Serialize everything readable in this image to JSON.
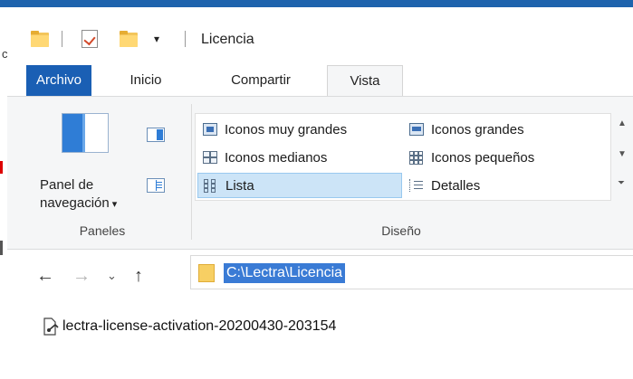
{
  "window": {
    "title": "Licencia"
  },
  "quick_access": {
    "icons": [
      "folder-icon",
      "properties-icon",
      "new-folder-icon",
      "customize-toolbar-icon"
    ]
  },
  "tabs": [
    {
      "label": "Archivo"
    },
    {
      "label": "Inicio"
    },
    {
      "label": "Compartir"
    },
    {
      "label": "Vista"
    }
  ],
  "ribbon": {
    "panes_group": {
      "nav_pane_label_line1": "Panel de",
      "nav_pane_label_line2": "navegación",
      "group_label": "Paneles"
    },
    "layout_group": {
      "items": [
        {
          "label": "Iconos muy grandes"
        },
        {
          "label": "Iconos grandes"
        },
        {
          "label": "Iconos medianos"
        },
        {
          "label": "Iconos pequeños"
        },
        {
          "label": "Lista"
        },
        {
          "label": "Detalles"
        }
      ],
      "selected": "Lista",
      "group_label": "Diseño"
    }
  },
  "address_bar": {
    "path": "C:\\Lectra\\Licencia"
  },
  "files": [
    {
      "name": "lectra-license-activation-20200430-203154"
    }
  ],
  "colors": {
    "accent": "#1a5fb4",
    "selection": "#cce4f7",
    "path_highlight": "#3a7bd5"
  }
}
